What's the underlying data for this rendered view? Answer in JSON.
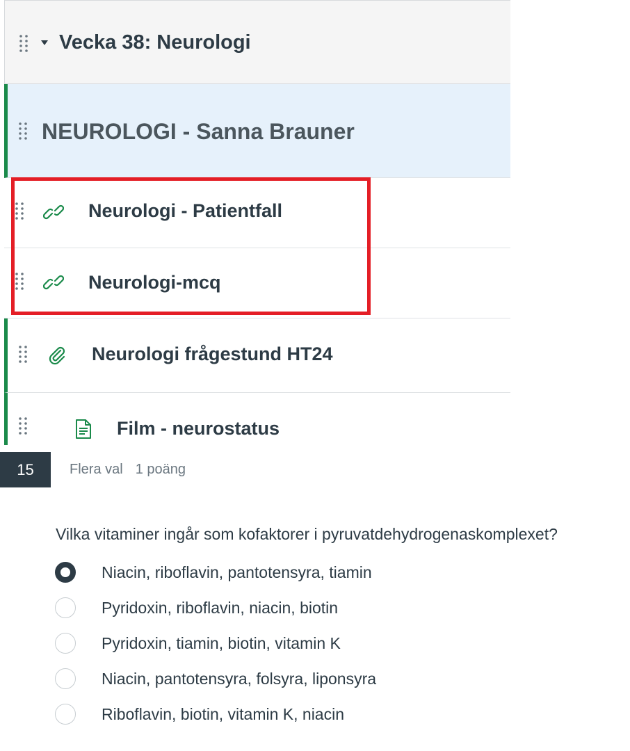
{
  "module": {
    "title": "Vecka 38: Neurologi",
    "items": [
      {
        "type": "subheader",
        "label": "NEUROLOGI - Sanna Brauner"
      },
      {
        "type": "link",
        "icon": "link-icon",
        "label": "Neurologi - Patientfall"
      },
      {
        "type": "link",
        "icon": "link-icon",
        "label": "Neurologi-mcq"
      },
      {
        "type": "attachment",
        "icon": "paperclip-icon",
        "label": "Neurologi frågestund HT24"
      },
      {
        "type": "page",
        "icon": "document-icon",
        "label": "Film - neurostatus"
      }
    ]
  },
  "question": {
    "number": "15",
    "type_label": "Flera val",
    "points": "1 poäng",
    "text": "Vilka vitaminer ingår som kofaktorer i pyruvatdehydrogenaskomplexet?",
    "options": [
      {
        "label": "Niacin, riboflavin, pantotensyra, tiamin",
        "selected": true
      },
      {
        "label": "Pyridoxin, riboflavin, niacin, biotin",
        "selected": false
      },
      {
        "label": "Pyridoxin, tiamin, biotin, vitamin K",
        "selected": false
      },
      {
        "label": "Niacin, pantotensyra, folsyra, liponsyra",
        "selected": false
      },
      {
        "label": "Riboflavin, biotin, vitamin K, niacin",
        "selected": false
      }
    ]
  },
  "colors": {
    "published": "#1a8a4a",
    "highlight": "#e41e26",
    "header_bg": "#f5f5f5",
    "subheader_bg": "#e6f1fb",
    "dark": "#2d3b45"
  }
}
